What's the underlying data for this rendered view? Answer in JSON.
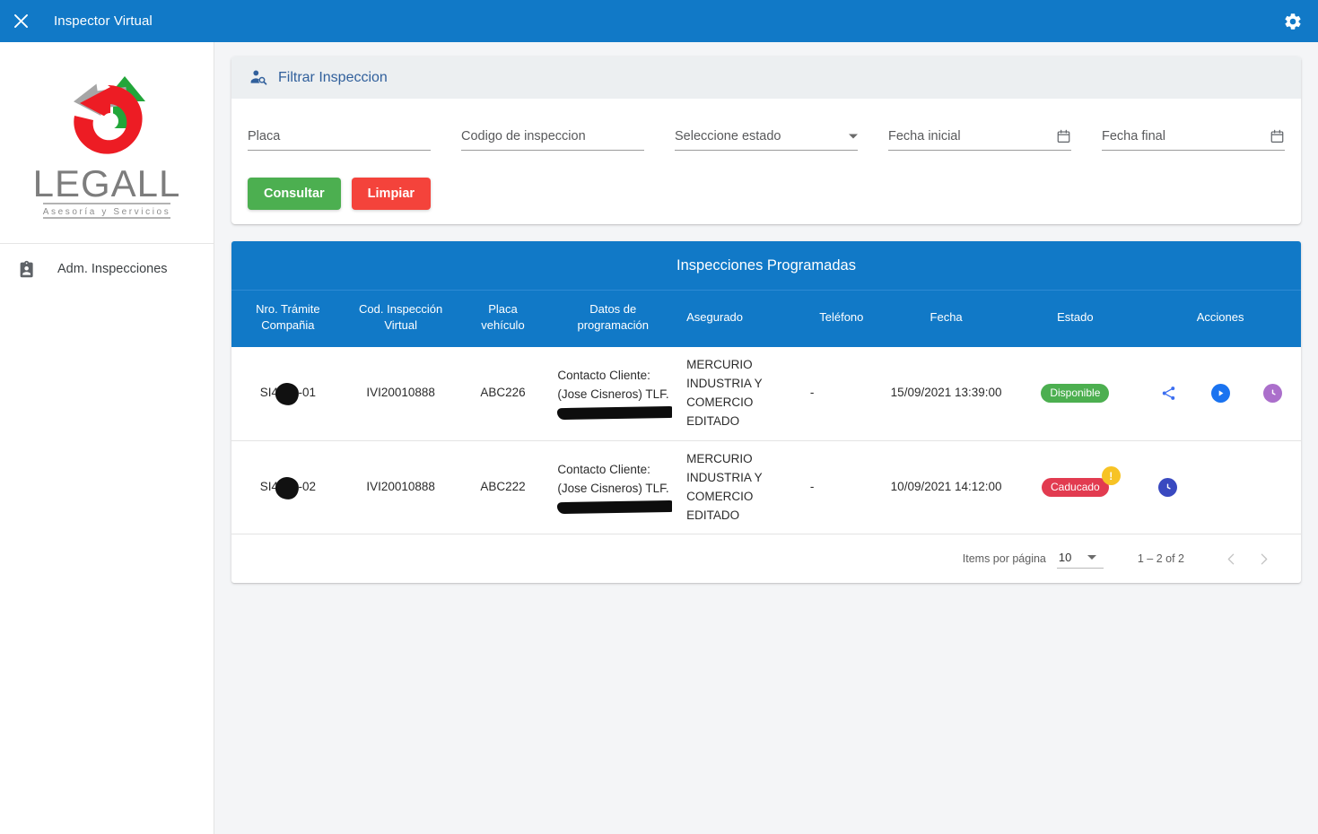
{
  "appbar": {
    "close_icon": "close-icon",
    "title": "Inspector Virtual",
    "gear_icon": "gear-icon",
    "background": "#1179c7"
  },
  "sidebar": {
    "logo": {
      "name": "LEGALL",
      "tagline": "Asesoría y Servicios",
      "colors": {
        "swoosh": "#ed1c24",
        "arrow_green": "#22a63a",
        "arrow_gray": "#a6a6a6",
        "wordmark": "#7d7d7d"
      }
    },
    "items": [
      {
        "icon": "badge-person-icon",
        "label": "Adm. Inspecciones"
      }
    ]
  },
  "filter": {
    "header_icon": "person-search-icon",
    "header_title": "Filtrar Inspeccion",
    "fields": [
      {
        "name": "placa",
        "placeholder": "Placa",
        "value": ""
      },
      {
        "name": "codigo",
        "placeholder": "Codigo de inspeccion",
        "value": ""
      },
      {
        "name": "estado",
        "placeholder": "Seleccione estado",
        "value": "",
        "trailing_icon": "chevron-down-icon"
      },
      {
        "name": "fecha-inicial",
        "placeholder": "Fecha inicial",
        "value": "",
        "trailing_icon": "calendar-icon"
      },
      {
        "name": "fecha-final",
        "placeholder": "Fecha final",
        "value": "",
        "trailing_icon": "calendar-icon"
      }
    ],
    "buttons": {
      "consultar": {
        "label": "Consultar",
        "color": "#4caf50"
      },
      "limpiar": {
        "label": "Limpiar",
        "color": "#f4433b"
      }
    }
  },
  "table": {
    "title": "Inspecciones Programadas",
    "header_color": "#1179c7",
    "columns": [
      "Nro. Trámite Compañia",
      "Cod. Inspección Virtual",
      "Placa vehículo",
      "Datos de programación",
      "Asegurado",
      "Teléfono",
      "Fecha",
      "Estado",
      "Acciones"
    ],
    "columns_split": [
      {
        "l1": "Nro. Trámite",
        "l2": "Compañia"
      },
      {
        "l1": "Cod. Inspección",
        "l2": "Virtual"
      },
      {
        "l1": "Placa",
        "l2": "vehículo"
      },
      {
        "l1": "Datos de",
        "l2": "programación"
      },
      {
        "l1": "Asegurado",
        "l2": ""
      },
      {
        "l1": "Teléfono",
        "l2": ""
      },
      {
        "l1": "Fecha",
        "l2": ""
      },
      {
        "l1": "Estado",
        "l2": ""
      },
      {
        "l1": "Acciones",
        "l2": ""
      }
    ],
    "rows": [
      {
        "tramite_prefix": "SI433",
        "tramite_suffix": "6-01",
        "tramite_redacted": true,
        "codigo": "IVI20010888",
        "placa": "ABC226",
        "datos_l1": "Contacto Cliente:",
        "datos_l2": "(Jose Cisneros) TLF.",
        "datos_l3_redacted": true,
        "asegurado_l1": "MERCURIO",
        "asegurado_l2": "INDUSTRIA Y",
        "asegurado_l3": "COMERCIO EDITADO",
        "telefono": "-",
        "fecha": "15/09/2021 13:39:00",
        "estado": "Disponible",
        "estado_color": "#4caf50",
        "alert": false,
        "actions": [
          {
            "icon": "share-icon",
            "color": "#1a73f0"
          },
          {
            "icon": "play-circle-icon",
            "color": "#1a73f0"
          },
          {
            "icon": "clock-circle-icon",
            "color": "#ab6fcb"
          }
        ]
      },
      {
        "tramite_prefix": "SI433",
        "tramite_suffix": "6-02",
        "tramite_redacted": true,
        "codigo": "IVI20010888",
        "placa": "ABC222",
        "datos_l1": "Contacto Cliente:",
        "datos_l2": "(Jose Cisneros) TLF.",
        "datos_l3_redacted": true,
        "asegurado_l1": "MERCURIO",
        "asegurado_l2": "INDUSTRIA Y",
        "asegurado_l3": "COMERCIO EDITADO",
        "telefono": "-",
        "fecha": "10/09/2021 14:12:00",
        "estado": "Caducado",
        "estado_color": "#e23b50",
        "alert": true,
        "alert_label": "!",
        "actions": [
          {
            "icon": "clock-circle-icon",
            "color": "#3949c0"
          }
        ]
      }
    ]
  },
  "paginator": {
    "items_label": "Items por página",
    "page_size": "10",
    "page_size_caret": "chevron-down-icon",
    "range": "1 – 2 of 2",
    "prev_icon": "chevron-left-icon",
    "next_icon": "chevron-right-icon"
  }
}
